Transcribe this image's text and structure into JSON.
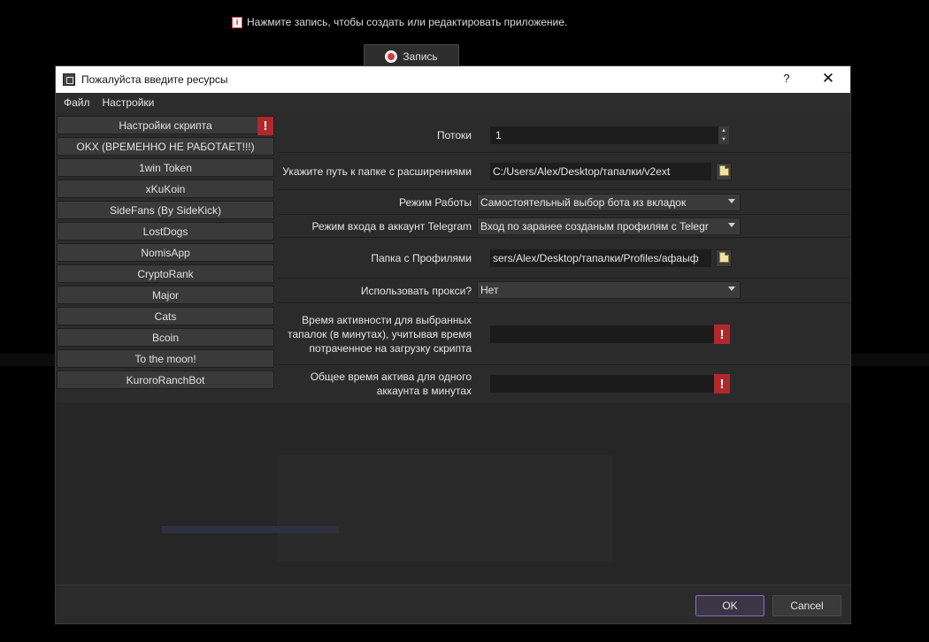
{
  "background": {
    "hint": "Нажмите запись, чтобы создать или редактировать приложение.",
    "record_label": "Запись"
  },
  "dialog": {
    "title": "Пожалуйста введите ресурсы",
    "help": "?",
    "close": "✕"
  },
  "menu": {
    "items": [
      "Файл",
      "Настройки"
    ]
  },
  "sidebar": {
    "items": [
      {
        "label": "Настройки скрипта",
        "warning": true
      },
      {
        "label": "OKX (ВРЕМЕННО НЕ РАБОТАЕТ!!!)"
      },
      {
        "label": "1win Token"
      },
      {
        "label": "xKuKoin"
      },
      {
        "label": "SideFans (By SideKick)"
      },
      {
        "label": "LostDogs"
      },
      {
        "label": "NomisApp"
      },
      {
        "label": "CryptoRank"
      },
      {
        "label": "Major"
      },
      {
        "label": "Cats"
      },
      {
        "label": "Bcoin"
      },
      {
        "label": "To the moon!"
      },
      {
        "label": "KuroroRanchBot"
      }
    ]
  },
  "form": {
    "threads_label": "Потоки",
    "threads_value": "1",
    "extensions_label": "Укажите путь к папке с расширениями",
    "extensions_value": "C:/Users/Alex/Desktop/тапалки/v2ext",
    "mode_label": "Режим Работы",
    "mode_value": "Самостоятельный выбор бота из вкладок",
    "tg_login_label": "Режим входа в аккаунт Telegram",
    "tg_login_value": "Вход по заранее созданым профилям с Telegr",
    "profiles_label": "Папка с Профилями",
    "profiles_value": "sers/Alex/Desktop/тапалки/Profiles/афаыф",
    "proxy_label": "Использовать прокси?",
    "proxy_value": "Нет",
    "activity_label": "Время активности для выбранных тапалок (в минутах), учитывая время потраченное на загрузку скрипта",
    "total_label": "Общее время актива для одного аккаунта в минутах"
  },
  "footer": {
    "ok": "OK",
    "cancel": "Cancel"
  },
  "colors": {
    "warning": "#b0282c",
    "ok_border": "#8a6ad0"
  }
}
